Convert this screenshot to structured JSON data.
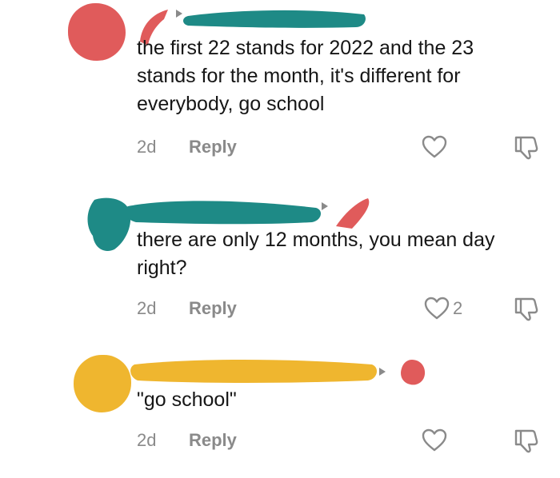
{
  "comments": [
    {
      "text": "the first 22 stands for 2022 and the 23 stands for the month, it's different for everybody, go school",
      "time": "2d",
      "reply_label": "Reply",
      "like_count": ""
    },
    {
      "text": "there are only 12 months, you mean day right?",
      "time": "2d",
      "reply_label": "Reply",
      "like_count": "2"
    },
    {
      "text": "\"go school\"",
      "time": "2d",
      "reply_label": "Reply",
      "like_count": ""
    }
  ],
  "colors": {
    "redact_red": "#e05b5b",
    "redact_teal": "#1e8a86",
    "redact_yellow": "#efb62f",
    "muted": "#8a8a8a"
  },
  "icons": [
    "heart-icon",
    "dislike-icon",
    "reply-arrow-icon"
  ]
}
